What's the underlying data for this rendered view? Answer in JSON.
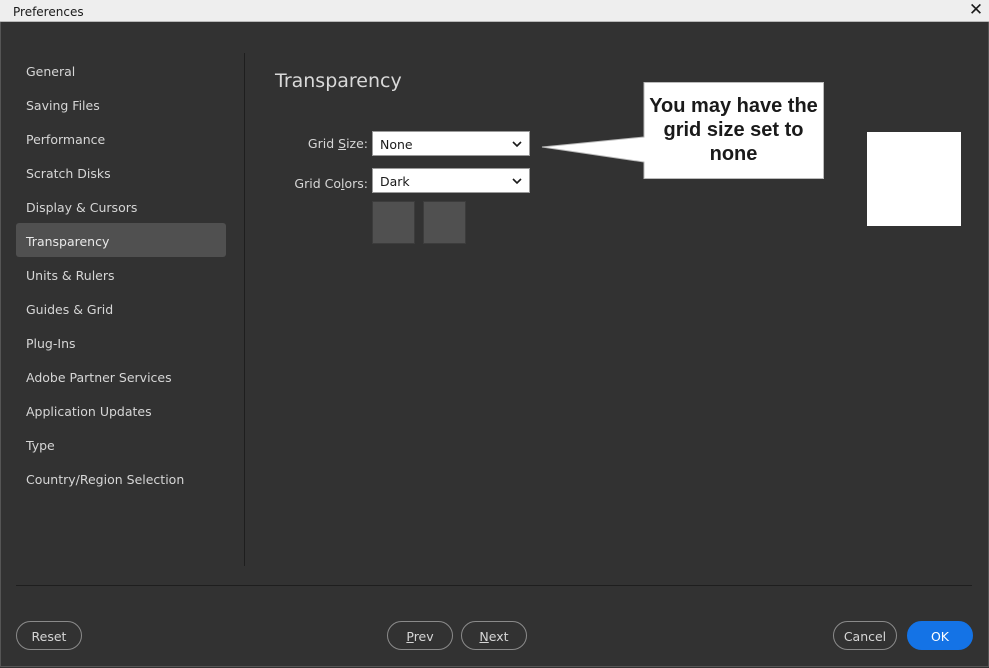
{
  "window": {
    "title": "Preferences",
    "close_glyph": "✕"
  },
  "sidebar": {
    "items": [
      {
        "label": "General"
      },
      {
        "label": "Saving Files"
      },
      {
        "label": "Performance"
      },
      {
        "label": "Scratch Disks"
      },
      {
        "label": "Display & Cursors"
      },
      {
        "label": "Transparency",
        "active": true
      },
      {
        "label": "Units & Rulers"
      },
      {
        "label": "Guides & Grid"
      },
      {
        "label": "Plug-Ins"
      },
      {
        "label": "Adobe Partner Services"
      },
      {
        "label": "Application Updates"
      },
      {
        "label": "Type"
      },
      {
        "label": "Country/Region Selection"
      }
    ]
  },
  "main": {
    "title": "Transparency",
    "grid_size": {
      "label_pre": "Grid ",
      "label_mnemonic": "S",
      "label_post": "ize:",
      "value": "None"
    },
    "grid_colors": {
      "label_pre": "Grid Co",
      "label_mnemonic": "l",
      "label_post": "ors:",
      "value": "Dark"
    }
  },
  "callout": {
    "text": "You may have the grid size set to none"
  },
  "footer": {
    "reset": "Reset",
    "prev_mnemonic": "P",
    "prev_rest": "rev",
    "next_mnemonic": "N",
    "next_rest": "ext",
    "cancel": "Cancel",
    "ok": "OK"
  },
  "colors": {
    "accent": "#1473e6",
    "background": "#323232",
    "active_item": "#505050"
  }
}
